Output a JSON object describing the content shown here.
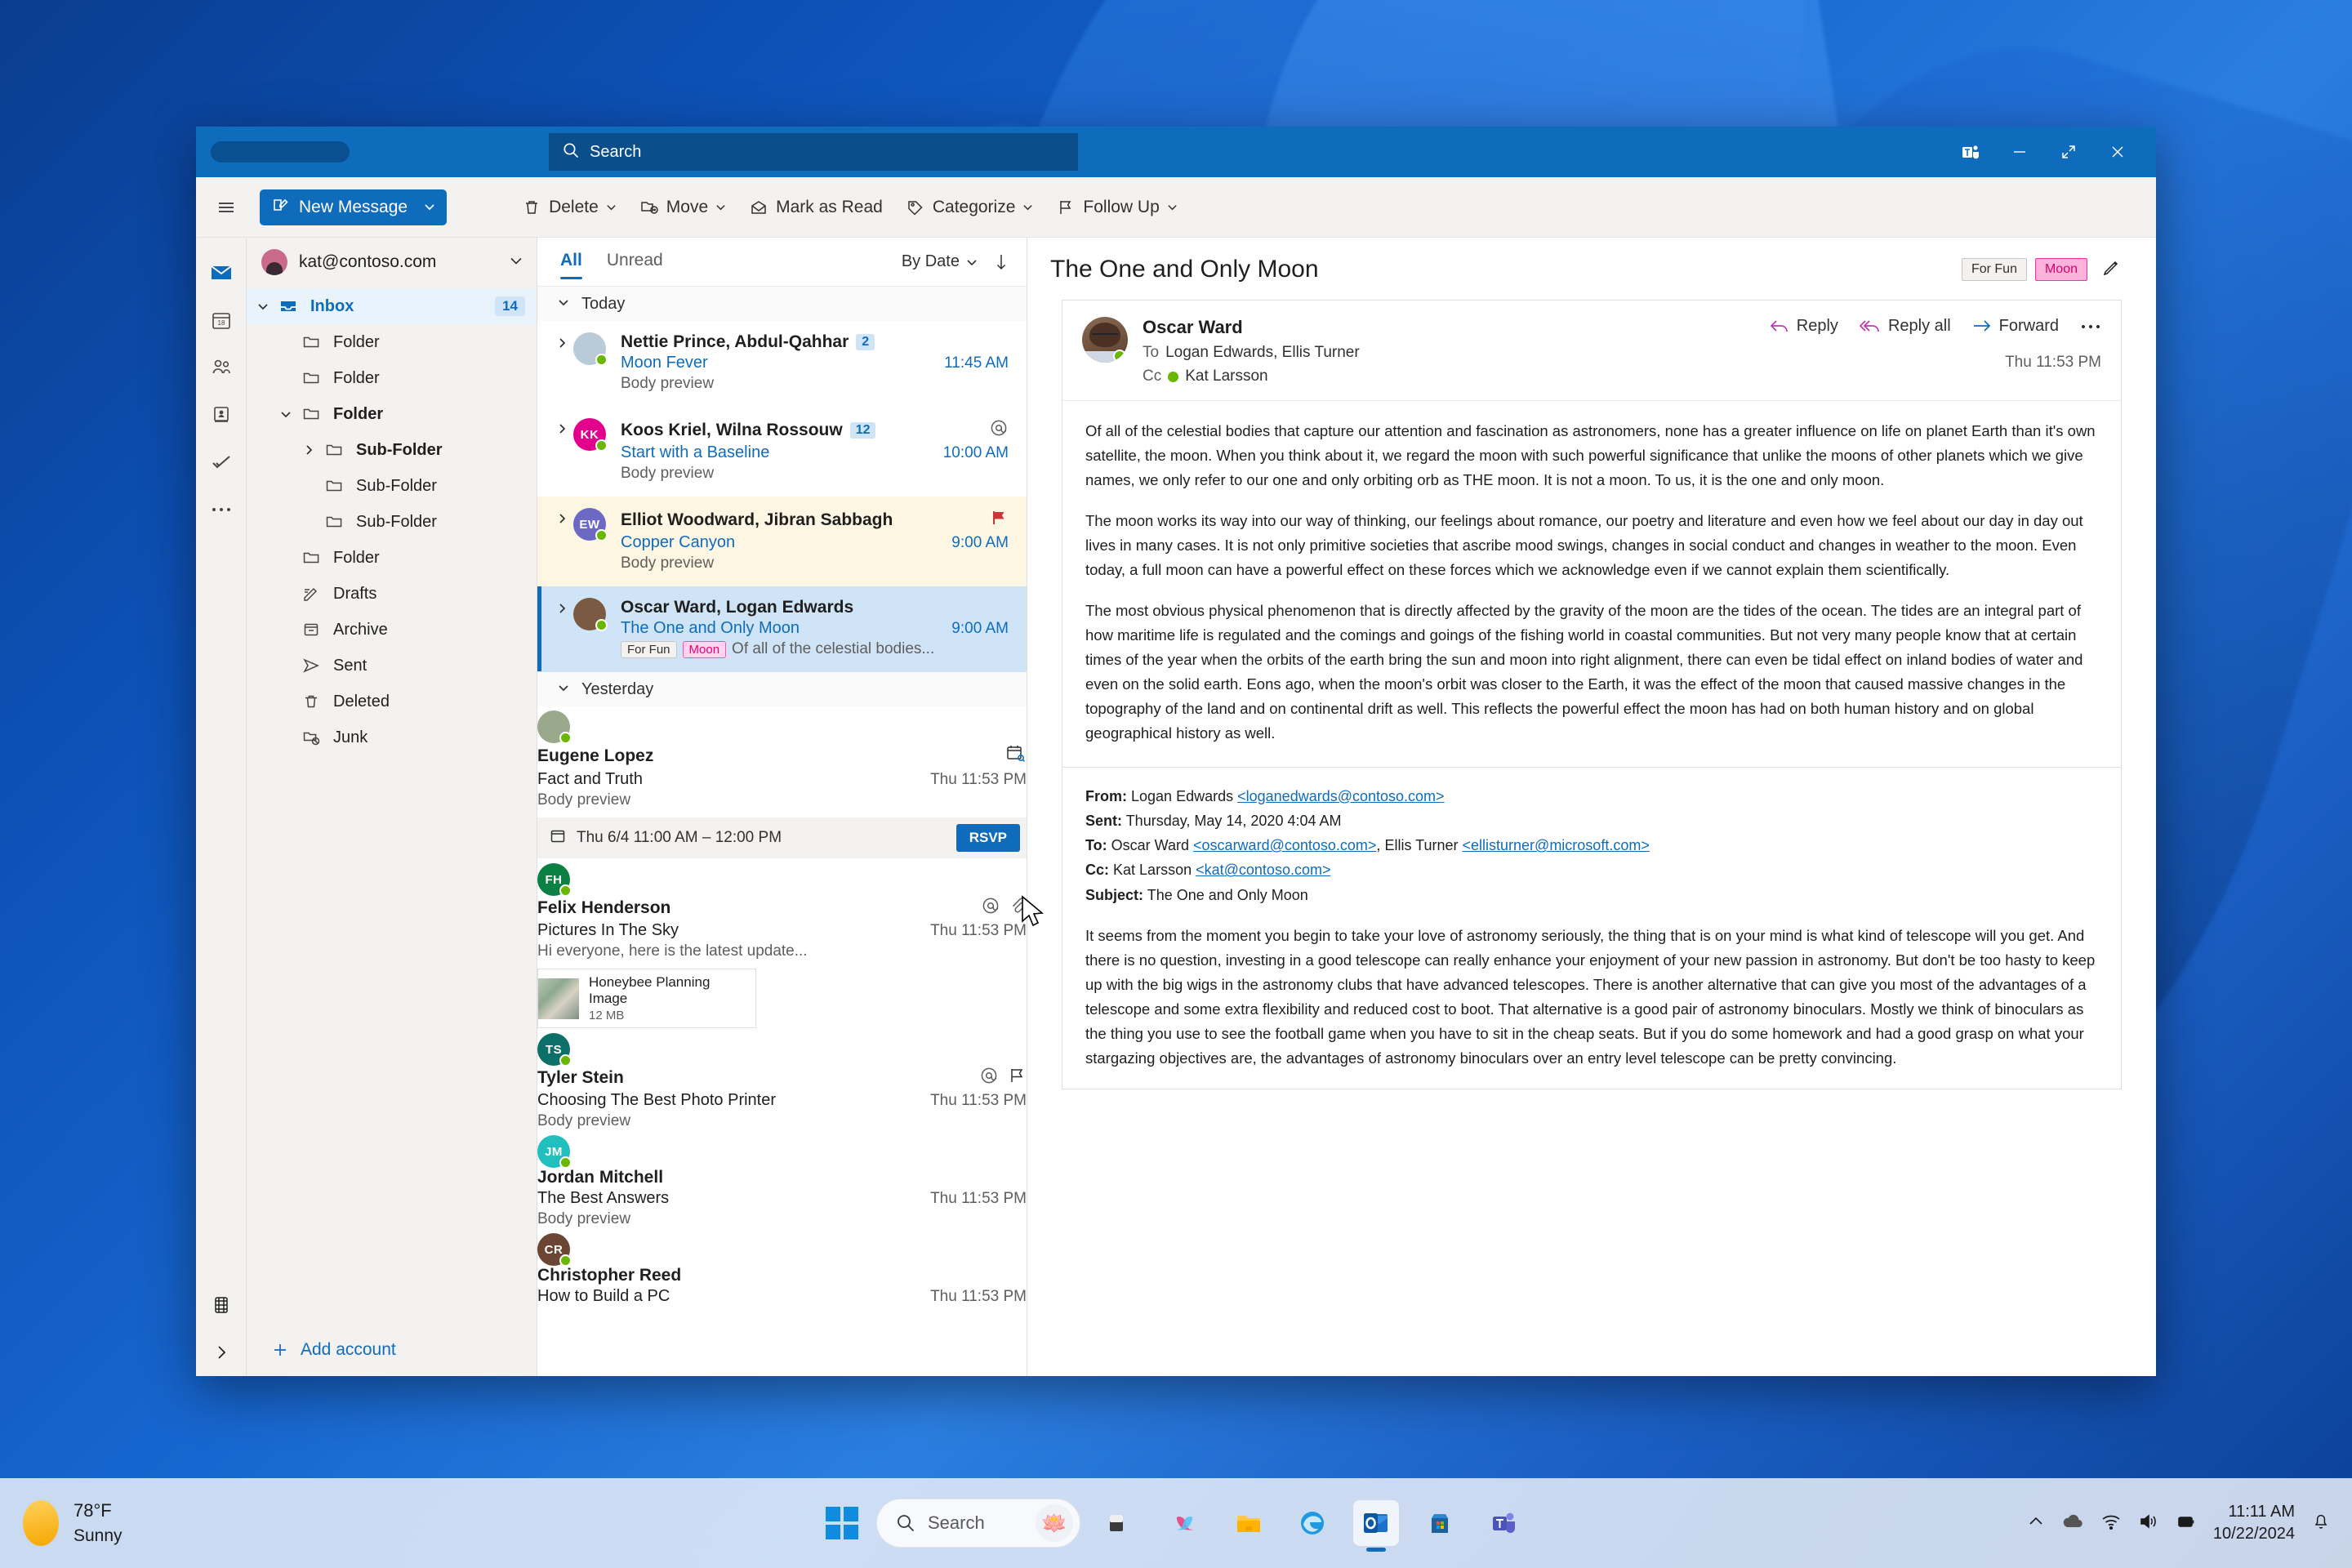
{
  "titlebar": {
    "search_placeholder": "Search",
    "search_icon": "search-icon",
    "teams_icon": "teams-icon",
    "minimize": "minimize-icon",
    "restore": "restore-icon",
    "close": "close-icon"
  },
  "commandbar": {
    "hamburger": "hamburger-menu-icon",
    "new_message": "New Message",
    "items": [
      {
        "label": "Delete",
        "icon": "trash-icon",
        "caret": true
      },
      {
        "label": "Move",
        "icon": "move-folder-icon",
        "caret": true
      },
      {
        "label": "Mark as Read",
        "icon": "envelope-open-icon",
        "caret": false
      },
      {
        "label": "Categorize",
        "icon": "tag-icon",
        "caret": true
      },
      {
        "label": "Follow Up",
        "icon": "flag-icon",
        "caret": true
      }
    ]
  },
  "rail": {
    "items": [
      "mail-icon",
      "calendar-icon",
      "people-icon",
      "contacts-book-icon",
      "tasks-icon",
      "more-icon"
    ],
    "bottom": [
      "apps-icon",
      "expand-pane-icon"
    ]
  },
  "folders": {
    "account": "kat@contoso.com",
    "account_caret": "chevron-down-icon",
    "add_account": "Add account",
    "tree": [
      {
        "label": "Inbox",
        "indent": 0,
        "icon": "inbox-icon",
        "chevron": "down",
        "badge": "14",
        "selected": true,
        "bold": true
      },
      {
        "label": "Folder",
        "indent": 1,
        "icon": "folder-icon",
        "chevron": "none",
        "badge": "",
        "selected": false,
        "bold": false
      },
      {
        "label": "Folder",
        "indent": 1,
        "icon": "folder-icon",
        "chevron": "none",
        "badge": "",
        "selected": false,
        "bold": false
      },
      {
        "label": "Folder",
        "indent": 1,
        "icon": "folder-icon",
        "chevron": "down",
        "badge": "",
        "selected": false,
        "bold": true
      },
      {
        "label": "Sub-Folder",
        "indent": 2,
        "icon": "folder-icon",
        "chevron": "right",
        "badge": "",
        "selected": false,
        "bold": true
      },
      {
        "label": "Sub-Folder",
        "indent": 2,
        "icon": "folder-icon",
        "chevron": "none",
        "badge": "",
        "selected": false,
        "bold": false
      },
      {
        "label": "Sub-Folder",
        "indent": 2,
        "icon": "folder-icon",
        "chevron": "none",
        "badge": "",
        "selected": false,
        "bold": false
      },
      {
        "label": "Folder",
        "indent": 1,
        "icon": "folder-icon",
        "chevron": "none",
        "badge": "",
        "selected": false,
        "bold": false
      },
      {
        "label": "Drafts",
        "indent": 1,
        "icon": "drafts-icon",
        "chevron": "none",
        "badge": "",
        "selected": false,
        "bold": false
      },
      {
        "label": "Archive",
        "indent": 1,
        "icon": "archive-icon",
        "chevron": "none",
        "badge": "",
        "selected": false,
        "bold": false
      },
      {
        "label": "Sent",
        "indent": 1,
        "icon": "sent-icon",
        "chevron": "none",
        "badge": "",
        "selected": false,
        "bold": false
      },
      {
        "label": "Deleted",
        "indent": 1,
        "icon": "trash-icon",
        "chevron": "none",
        "badge": "",
        "selected": false,
        "bold": false
      },
      {
        "label": "Junk",
        "indent": 1,
        "icon": "junk-icon",
        "chevron": "none",
        "badge": "",
        "selected": false,
        "bold": false
      }
    ]
  },
  "messagelist": {
    "tab_all": "All",
    "tab_unread": "Unread",
    "sort_label": "By Date",
    "sort_caret": "chevron-down-icon",
    "sort_direction": "arrow-down-icon",
    "groups": [
      {
        "label": "Today",
        "messages": [
          {
            "from": "Nettie Prince, Abdul-Qahhar",
            "count": "2",
            "subject": "Moon Fever",
            "preview": "Body preview",
            "time": "11:45 AM",
            "avatar_text": "",
            "avatar_color": "#b9cbd8",
            "avatar_photo": true,
            "expander": true,
            "read": false,
            "flagged": false,
            "selected": false,
            "icons": [],
            "tags": []
          },
          {
            "from": "Koos Kriel, Wilna Rossouw",
            "count": "12",
            "subject": "Start with a Baseline",
            "preview": "Body preview",
            "time": "10:00 AM",
            "avatar_text": "KK",
            "avatar_color": "#e3008c",
            "avatar_photo": false,
            "expander": true,
            "read": false,
            "flagged": false,
            "selected": false,
            "icons": [
              "mention-icon"
            ],
            "tags": []
          },
          {
            "from": "Elliot Woodward, Jibran Sabbagh",
            "count": "",
            "subject": "Copper Canyon",
            "preview": "Body preview",
            "time": "9:00 AM",
            "avatar_text": "EW",
            "avatar_color": "#6b69c4",
            "avatar_photo": false,
            "expander": true,
            "read": false,
            "flagged": true,
            "selected": false,
            "icons": [
              "flag-filled-icon"
            ],
            "tags": []
          },
          {
            "from": "Oscar Ward, Logan Edwards",
            "count": "",
            "subject": "The One and Only Moon",
            "preview": "Of all of the celestial bodies...",
            "time": "9:00 AM",
            "avatar_text": "",
            "avatar_color": "#7a5a42",
            "avatar_photo": true,
            "expander": true,
            "read": false,
            "flagged": false,
            "selected": true,
            "icons": [],
            "tags": [
              "For Fun",
              "Moon"
            ]
          }
        ]
      },
      {
        "label": "Yesterday",
        "messages": [
          {
            "from": "Eugene Lopez",
            "count": "",
            "subject": "Fact and Truth",
            "preview": "Body preview",
            "time": "Thu 11:53 PM",
            "avatar_text": "",
            "avatar_color": "#9aa88c",
            "avatar_photo": true,
            "expander": false,
            "read": true,
            "flagged": false,
            "selected": false,
            "icons": [
              "calendar-invite-icon"
            ],
            "tags": [],
            "event": {
              "icon": "calendar-icon",
              "text": "Thu 6/4 11:00 AM – 12:00 PM",
              "button": "RSVP"
            }
          },
          {
            "from": "Felix Henderson",
            "count": "",
            "subject": "Pictures In The Sky",
            "preview": "Hi everyone, here is the latest update...",
            "time": "Thu 11:53 PM",
            "avatar_text": "FH",
            "avatar_color": "#0b8043",
            "avatar_photo": false,
            "expander": false,
            "read": true,
            "flagged": false,
            "selected": false,
            "icons": [
              "mention-icon",
              "paperclip-icon"
            ],
            "tags": [],
            "attachment": {
              "name": "Honeybee Planning Image",
              "size": "12 MB"
            }
          },
          {
            "from": "Tyler Stein",
            "count": "",
            "subject": "Choosing The Best Photo Printer",
            "preview": "Body preview",
            "time": "Thu 11:53 PM",
            "avatar_text": "TS",
            "avatar_color": "#0d7068",
            "avatar_photo": false,
            "expander": false,
            "read": true,
            "flagged": false,
            "selected": false,
            "icons": [
              "mention-icon",
              "flag-outline-icon"
            ],
            "tags": []
          },
          {
            "from": "Jordan Mitchell",
            "count": "",
            "subject": "The Best Answers",
            "preview": "Body preview",
            "time": "Thu 11:53 PM",
            "avatar_text": "JM",
            "avatar_color": "#22bfbf",
            "avatar_photo": false,
            "expander": false,
            "read": true,
            "flagged": false,
            "selected": false,
            "icons": [],
            "tags": []
          },
          {
            "from": "Christopher Reed",
            "count": "",
            "subject": "How to Build a PC",
            "preview": "",
            "time": "Thu 11:53 PM",
            "avatar_text": "CR",
            "avatar_color": "#6d4534",
            "avatar_photo": false,
            "expander": false,
            "read": true,
            "flagged": false,
            "selected": false,
            "icons": [],
            "tags": []
          }
        ]
      }
    ]
  },
  "reading": {
    "title": "The One and Only Moon",
    "tags": [
      "For Fun",
      "Moon"
    ],
    "tag_tool_icon": "highlighter-icon",
    "sender": "Oscar Ward",
    "to_label": "To",
    "to_value": "Logan Edwards, Ellis Turner",
    "cc_label": "Cc",
    "cc_value": "Kat Larsson",
    "timestamp": "Thu 11:53 PM",
    "actions": [
      {
        "label": "Reply",
        "icon": "reply-icon"
      },
      {
        "label": "Reply all",
        "icon": "reply-all-icon"
      },
      {
        "label": "Forward",
        "icon": "forward-icon"
      }
    ],
    "more_icon": "ellipsis-icon",
    "paragraphs": [
      "Of all of the celestial bodies that capture our attention and fascination as astronomers, none has a greater influence on life on planet Earth than it's own satellite, the moon. When you think about it, we regard the moon with such powerful significance that unlike the moons of other planets which we give names, we only refer to our one and only orbiting orb as THE moon. It is not a moon. To us, it is the one and only moon.",
      "The moon works its way into our way of thinking, our feelings about romance, our poetry and literature and even how we feel about our day in day out lives in many cases. It is not only primitive societies that ascribe mood swings, changes in social conduct and changes in weather to the moon. Even today, a full moon can have a powerful effect on these forces which we acknowledge even if we cannot explain them scientifically.",
      "The most obvious physical phenomenon that is directly affected by the gravity of the moon are the tides of the ocean. The tides are an integral part of how maritime life is regulated and the comings and goings of the fishing world in coastal communities. But not very many people know that at certain times of the year when the orbits of the earth bring the sun and moon into right alignment, there can even be tidal effect on inland bodies of water and even on the solid earth. Eons ago, when the moon's orbit was closer to the Earth, it was the effect of the moon that caused massive changes in the topography of the land and on continental drift as well. This reflects the powerful effect the moon has had on both human history and on global geographical history as well."
    ],
    "quoted": {
      "from_label": "From:",
      "from_name": "Logan Edwards",
      "from_email": "<loganedwards@contoso.com>",
      "sent_label": "Sent:",
      "sent_value": "Thursday, May 14, 2020 4:04 AM",
      "to_label": "To:",
      "to_name1": "Oscar Ward",
      "to_email1": "<oscarward@contoso.com>",
      "to_name2": "Ellis Turner",
      "to_email2": "<ellisturner@microsoft.com>",
      "cc_label": "Cc:",
      "cc_name": "Kat Larsson",
      "cc_email": "<kat@contoso.com>",
      "subject_label": "Subject:",
      "subject_value": "The One and Only Moon",
      "body": "It seems from the moment you begin to take your love of astronomy seriously, the thing that is on your mind is what kind of telescope will you get. And there is no question, investing in a good telescope can really enhance your enjoyment of your new passion in astronomy. But don't be too hasty to keep up with the big wigs in the astronomy clubs that have advanced telescopes. There is another alternative that can give you most of the advantages of a telescope and some extra flexibility and reduced cost to boot. That alternative is a good pair of astronomy binoculars. Mostly we think of binoculars as the thing you use to see the football game when you have to sit in the cheap seats. But if you do some homework and had a good grasp on what your stargazing objectives are, the advantages of astronomy binoculars over an entry level telescope can be pretty convincing."
    }
  },
  "taskbar": {
    "weather_temp": "78°F",
    "weather_cond": "Sunny",
    "start_icon": "windows-start-icon",
    "search_placeholder": "Search",
    "search_icon": "search-icon",
    "lotus_icon": "🪷",
    "apps": [
      "task-view-icon",
      "copilot-icon",
      "file-explorer-icon",
      "edge-icon",
      "outlook-icon",
      "microsoft-store-icon",
      "teams-icon"
    ],
    "tray": [
      "show-hidden-icons-icon",
      "onedrive-icon",
      "wifi-icon",
      "volume-icon",
      "battery-icon"
    ],
    "clock_time": "11:11 AM",
    "clock_date": "10/22/2024",
    "notification_icon": "bell-icon"
  },
  "colors": {
    "accent": "#0f6cbd",
    "selected_row": "#cfe4f7",
    "flag_row": "#fdf6e3",
    "pink_tag": "#ff2ea6"
  }
}
